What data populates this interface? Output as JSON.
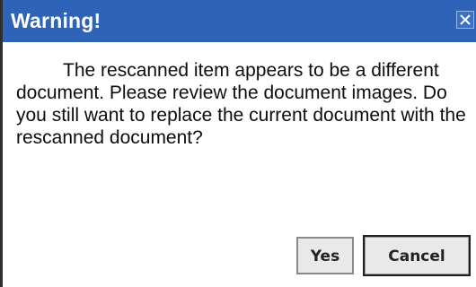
{
  "dialog": {
    "title": "Warning!",
    "close_icon": "close-x-icon",
    "message": "The rescanned item appears to be a different document. Please review the document images. Do you still want to replace the current document with the rescanned document?",
    "buttons": {
      "yes_label": "Yes",
      "cancel_label": "Cancel"
    },
    "colors": {
      "title_bar": "#2f63b8",
      "title_text": "#ffffff",
      "background": "#ffffff"
    }
  }
}
